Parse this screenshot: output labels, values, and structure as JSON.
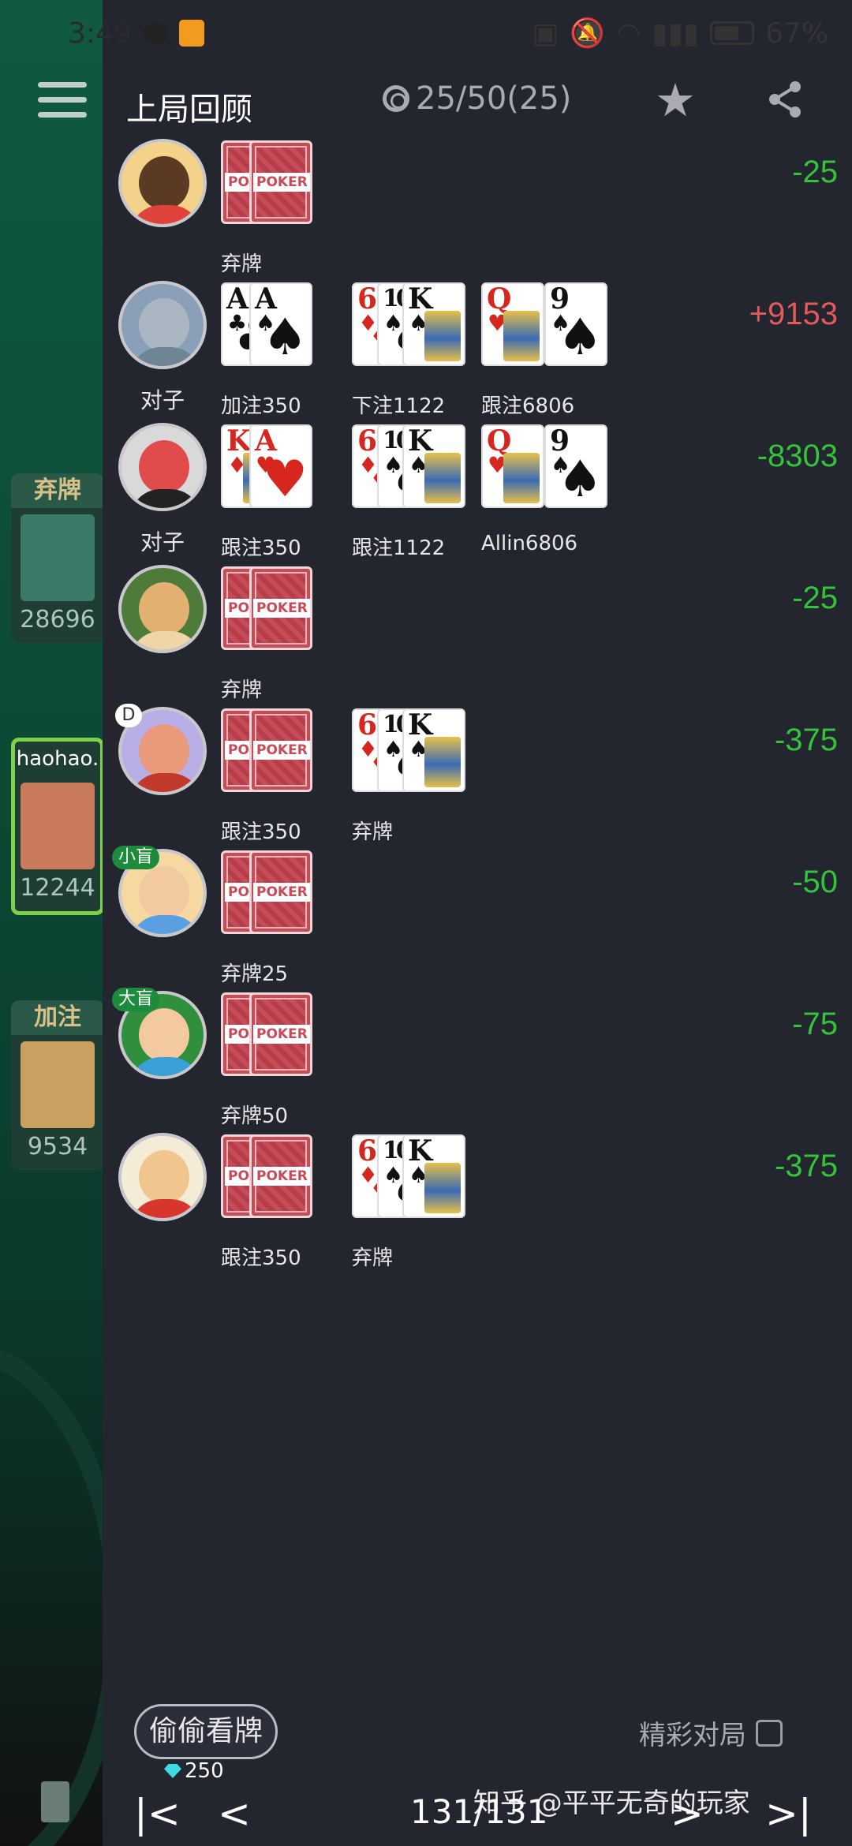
{
  "status": {
    "time": "3:49",
    "battery": "67%",
    "app_badge": "房"
  },
  "header": {
    "title": "上局回顾",
    "counter": "25/50(25)"
  },
  "side": {
    "cards": [
      {
        "tag": "弃牌",
        "num": "28696"
      },
      {
        "tag": "haohao.",
        "num": "12244"
      },
      {
        "tag": "加注",
        "num": "9534"
      }
    ]
  },
  "rows": [
    {
      "label": "",
      "badge": "",
      "amount": "-25",
      "sign": "neg",
      "avatar_colors": [
        "#f4d28a",
        "#5a3a22",
        "#e0433c"
      ],
      "groups": [
        {
          "cards": [
            {
              "back": true
            },
            {
              "back": true
            }
          ],
          "action": "弃牌"
        }
      ]
    },
    {
      "label": "对子",
      "badge": "",
      "amount": "+9153",
      "sign": "pos",
      "avatar_colors": [
        "#8aa0b8",
        "#aab6c2",
        "#6f8596"
      ],
      "groups": [
        {
          "cards": [
            {
              "r": "A",
              "s": "♣",
              "c": "black"
            },
            {
              "r": "A",
              "s": "♠",
              "c": "black"
            }
          ],
          "action": "加注350"
        },
        {
          "cards": [
            {
              "r": "6",
              "s": "♦",
              "c": "red"
            },
            {
              "r": "10",
              "s": "♠",
              "c": "black"
            },
            {
              "r": "K",
              "s": "♠",
              "c": "black"
            }
          ],
          "action": "下注1122"
        },
        {
          "cards": [
            {
              "r": "Q",
              "s": "♥",
              "c": "red"
            }
          ],
          "action": "跟注6806"
        },
        {
          "cards": [
            {
              "r": "9",
              "s": "♠",
              "c": "black"
            }
          ],
          "action": ""
        }
      ]
    },
    {
      "label": "对子",
      "badge": "",
      "amount": "-8303",
      "sign": "neg",
      "avatar_colors": [
        "#d9d9d9",
        "#e04b4b",
        "#222"
      ],
      "groups": [
        {
          "cards": [
            {
              "r": "K",
              "s": "♦",
              "c": "red"
            },
            {
              "r": "A",
              "s": "♥",
              "c": "red"
            }
          ],
          "action": "跟注350"
        },
        {
          "cards": [
            {
              "r": "6",
              "s": "♦",
              "c": "red"
            },
            {
              "r": "10",
              "s": "♠",
              "c": "black"
            },
            {
              "r": "K",
              "s": "♠",
              "c": "black"
            }
          ],
          "action": "跟注1122"
        },
        {
          "cards": [
            {
              "r": "Q",
              "s": "♥",
              "c": "red"
            }
          ],
          "action": "Allin6806"
        },
        {
          "cards": [
            {
              "r": "9",
              "s": "♠",
              "c": "black"
            }
          ],
          "action": ""
        }
      ]
    },
    {
      "label": "",
      "badge": "",
      "amount": "-25",
      "sign": "neg",
      "avatar_colors": [
        "#4e7a3a",
        "#e2b071",
        "#f0d5a8"
      ],
      "groups": [
        {
          "cards": [
            {
              "back": true
            },
            {
              "back": true
            }
          ],
          "action": "弃牌"
        }
      ]
    },
    {
      "label": "",
      "badge": "D",
      "amount": "-375",
      "sign": "neg",
      "avatar_colors": [
        "#b9aee6",
        "#e89a7a",
        "#c0392b"
      ],
      "groups": [
        {
          "cards": [
            {
              "back": true
            },
            {
              "back": true
            }
          ],
          "action": "跟注350"
        },
        {
          "cards": [
            {
              "r": "6",
              "s": "♦",
              "c": "red"
            },
            {
              "r": "10",
              "s": "♠",
              "c": "black"
            },
            {
              "r": "K",
              "s": "♠",
              "c": "black"
            }
          ],
          "action": "弃牌"
        }
      ]
    },
    {
      "label": "",
      "badge": "小盲",
      "amount": "-50",
      "sign": "neg",
      "avatar_colors": [
        "#f6d8a0",
        "#f2c9a0",
        "#5aa0e0"
      ],
      "groups": [
        {
          "cards": [
            {
              "back": true
            },
            {
              "back": true
            }
          ],
          "action": "弃牌25"
        }
      ]
    },
    {
      "label": "",
      "badge": "大盲",
      "amount": "-75",
      "sign": "neg",
      "avatar_colors": [
        "#2f8f3c",
        "#f2c9a0",
        "#3aa0d8"
      ],
      "groups": [
        {
          "cards": [
            {
              "back": true
            },
            {
              "back": true
            }
          ],
          "action": "弃牌50"
        }
      ]
    },
    {
      "label": "",
      "badge": "",
      "amount": "-375",
      "sign": "neg",
      "avatar_colors": [
        "#f5ecd8",
        "#f0c58e",
        "#d9352f"
      ],
      "groups": [
        {
          "cards": [
            {
              "back": true
            },
            {
              "back": true
            }
          ],
          "action": "跟注350"
        },
        {
          "cards": [
            {
              "r": "6",
              "s": "♦",
              "c": "red"
            },
            {
              "r": "10",
              "s": "♠",
              "c": "black"
            },
            {
              "r": "K",
              "s": "♠",
              "c": "black"
            }
          ],
          "action": "弃牌"
        }
      ]
    }
  ],
  "card_back_text": "POKER",
  "footer": {
    "peek_label": "偷偷看牌",
    "gems": "250",
    "highlight_label": "精彩对局",
    "page": "131/131"
  },
  "watermark": "知乎 @平平无奇的玩家"
}
